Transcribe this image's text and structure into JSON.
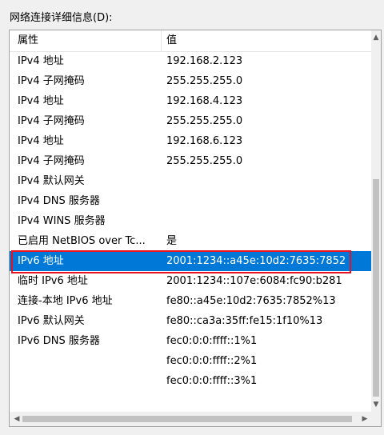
{
  "section_label": "网络连接详细信息(D):",
  "columns": {
    "property": "属性",
    "value": "值"
  },
  "rows": [
    {
      "property": "IPv4 地址",
      "value": "192.168.2.123"
    },
    {
      "property": "IPv4 子网掩码",
      "value": "255.255.255.0"
    },
    {
      "property": "IPv4 地址",
      "value": "192.168.4.123"
    },
    {
      "property": "IPv4 子网掩码",
      "value": "255.255.255.0"
    },
    {
      "property": "IPv4 地址",
      "value": "192.168.6.123"
    },
    {
      "property": "IPv4 子网掩码",
      "value": "255.255.255.0"
    },
    {
      "property": "IPv4 默认网关",
      "value": ""
    },
    {
      "property": "IPv4 DNS 服务器",
      "value": ""
    },
    {
      "property": "IPv4 WINS 服务器",
      "value": ""
    },
    {
      "property": "已启用 NetBIOS over Tc...",
      "value": "是"
    },
    {
      "property": "IPv6 地址",
      "value": "2001:1234::a45e:10d2:7635:7852"
    },
    {
      "property": "临时 IPv6 地址",
      "value": "2001:1234::107e:6084:fc90:b281"
    },
    {
      "property": "连接-本地 IPv6 地址",
      "value": "fe80::a45e:10d2:7635:7852%13"
    },
    {
      "property": "IPv6 默认网关",
      "value": "fe80::ca3a:35ff:fe15:1f10%13"
    },
    {
      "property": "IPv6 DNS 服务器",
      "value": "fec0:0:0:ffff::1%1"
    },
    {
      "property": "",
      "value": "fec0:0:0:ffff::2%1"
    },
    {
      "property": "",
      "value": "fec0:0:0:ffff::3%1"
    }
  ],
  "selected_row": 10,
  "colors": {
    "selection": "#0078d7",
    "highlight_border": "#e81123"
  },
  "icons": {
    "scroll_up": "▲",
    "scroll_down": "▼",
    "scroll_left": "◀",
    "scroll_right": "▶"
  }
}
